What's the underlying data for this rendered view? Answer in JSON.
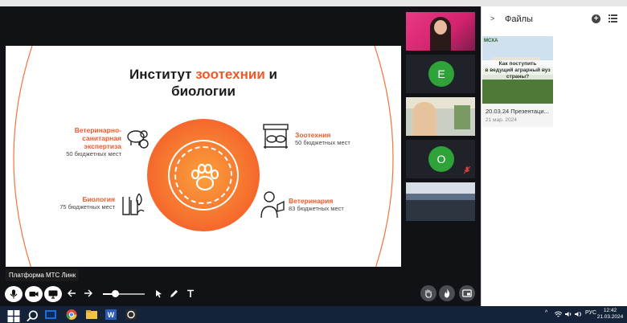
{
  "slide": {
    "title_pre": "Институт ",
    "title_accent": "зоотехнии",
    "title_post": " и",
    "title_line2": "биологии",
    "items": [
      {
        "name1": "Ветеринарно-",
        "name2": "санитарная экспертиза",
        "sub": "50 бюджетных мест"
      },
      {
        "name1": "Зоотехния",
        "sub": "50 бюджетных мест"
      },
      {
        "name1": "Биология",
        "sub": "75 бюджетных мест"
      },
      {
        "name1": "Ветеринария",
        "sub": "83 бюджетных мест"
      }
    ]
  },
  "participants": [
    {
      "type": "video",
      "label": "participant-1"
    },
    {
      "type": "avatar",
      "initial": "Е",
      "color": "#2fa23a"
    },
    {
      "type": "video",
      "label": "participant-3"
    },
    {
      "type": "avatar",
      "initial": "О",
      "color": "#2fa23a",
      "muted": true
    },
    {
      "type": "video",
      "label": "participant-5"
    }
  ],
  "panel": {
    "title": "Файлы",
    "file": {
      "thumb_logo": "МСХА",
      "thumb_line1": "Как поступить",
      "thumb_line2": "в ведущий аграрный вуз",
      "thumb_line3": "страны?",
      "name": "20.03.24 Презентаци...",
      "date": "21 мар. 2024"
    }
  },
  "tooltip": "Платформа МТС Линк",
  "slider": {
    "value": 0.3
  },
  "colors": {
    "accent": "#ec5a2a",
    "taskbar": "#14233a"
  },
  "taskbar": {
    "lang": "РУС",
    "time": "12:42",
    "date": "21.03.2024"
  },
  "icons": [
    "mic-icon",
    "camera-icon",
    "screen-icon",
    "arrow-left-icon",
    "arrow-right-icon",
    "cursor-icon",
    "pen-icon",
    "text-icon",
    "hand-icon",
    "fire-icon",
    "layout-icon",
    "windows-icon",
    "search-icon",
    "chrome-icon",
    "word-icon"
  ]
}
